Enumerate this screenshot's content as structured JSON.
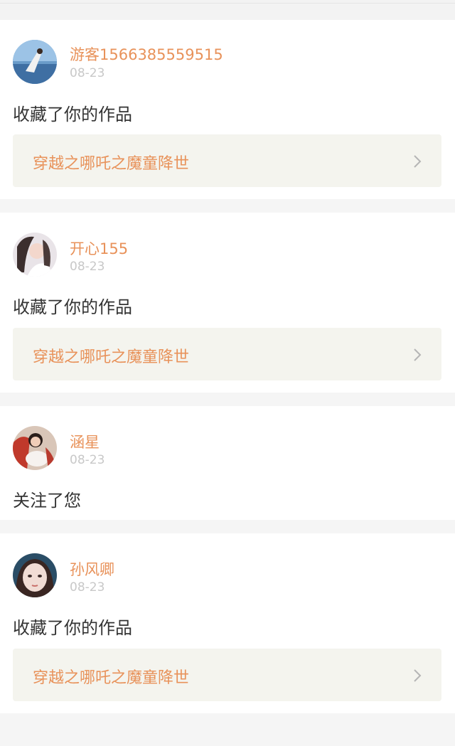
{
  "notifications": [
    {
      "user": "游客1566385559515",
      "date": "08-23",
      "action": "收藏了你的作品",
      "work_title": "穿越之哪吒之魔童降世",
      "avatar_icon": "user-avatar-photo",
      "arrow_icon": "chevron-right-icon"
    },
    {
      "user": "开心155",
      "date": "08-23",
      "action": "收藏了你的作品",
      "work_title": "穿越之哪吒之魔童降世",
      "avatar_icon": "user-avatar-photo",
      "arrow_icon": "chevron-right-icon"
    },
    {
      "user": "涵星",
      "date": "08-23",
      "action": "关注了您",
      "avatar_icon": "user-avatar-photo"
    },
    {
      "user": "孙风卿",
      "date": "08-23",
      "action": "收藏了你的作品",
      "work_title": "穿越之哪吒之魔童降世",
      "avatar_icon": "user-avatar-photo",
      "arrow_icon": "chevron-right-icon"
    }
  ],
  "colors": {
    "accent": "#e8925a",
    "page_background": "#f5f5f5",
    "card_background": "#ffffff",
    "work_link_background": "#f4f4ee",
    "date_text": "#c8c8c8",
    "body_text": "#333333"
  }
}
